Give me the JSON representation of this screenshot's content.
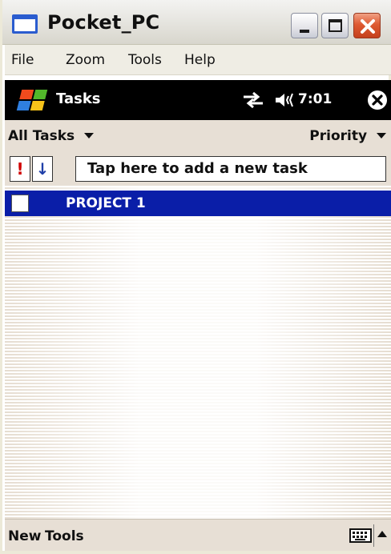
{
  "window": {
    "title": "Pocket_PC",
    "buttons": [
      "minimize",
      "maximize",
      "close"
    ]
  },
  "menubar": {
    "items": [
      "File",
      "Zoom",
      "Tools",
      "Help"
    ]
  },
  "navbar": {
    "title": "Tasks",
    "time": "7:01",
    "icons": [
      "start-flag-icon",
      "connectivity-icon",
      "volume-icon",
      "close-circle-icon"
    ]
  },
  "taskheader": {
    "filter": "All Tasks",
    "sort": "Priority"
  },
  "entrybar": {
    "priority_symbol": "!",
    "sort_symbol": "↓",
    "placeholder": "Tap here to add a new task"
  },
  "tasks": [
    {
      "name": "PROJECT 1",
      "completed": false,
      "selected": true
    }
  ],
  "cmdbar": {
    "new_label": "New",
    "tools_label": "Tools",
    "icons": [
      "keyboard-icon",
      "sip-arrow-up-icon"
    ]
  },
  "colors": {
    "selection": "#0a1ea8",
    "navbar_bg": "#000000",
    "chrome_bg": "#e7dfd5",
    "priority_red": "#d00000"
  }
}
